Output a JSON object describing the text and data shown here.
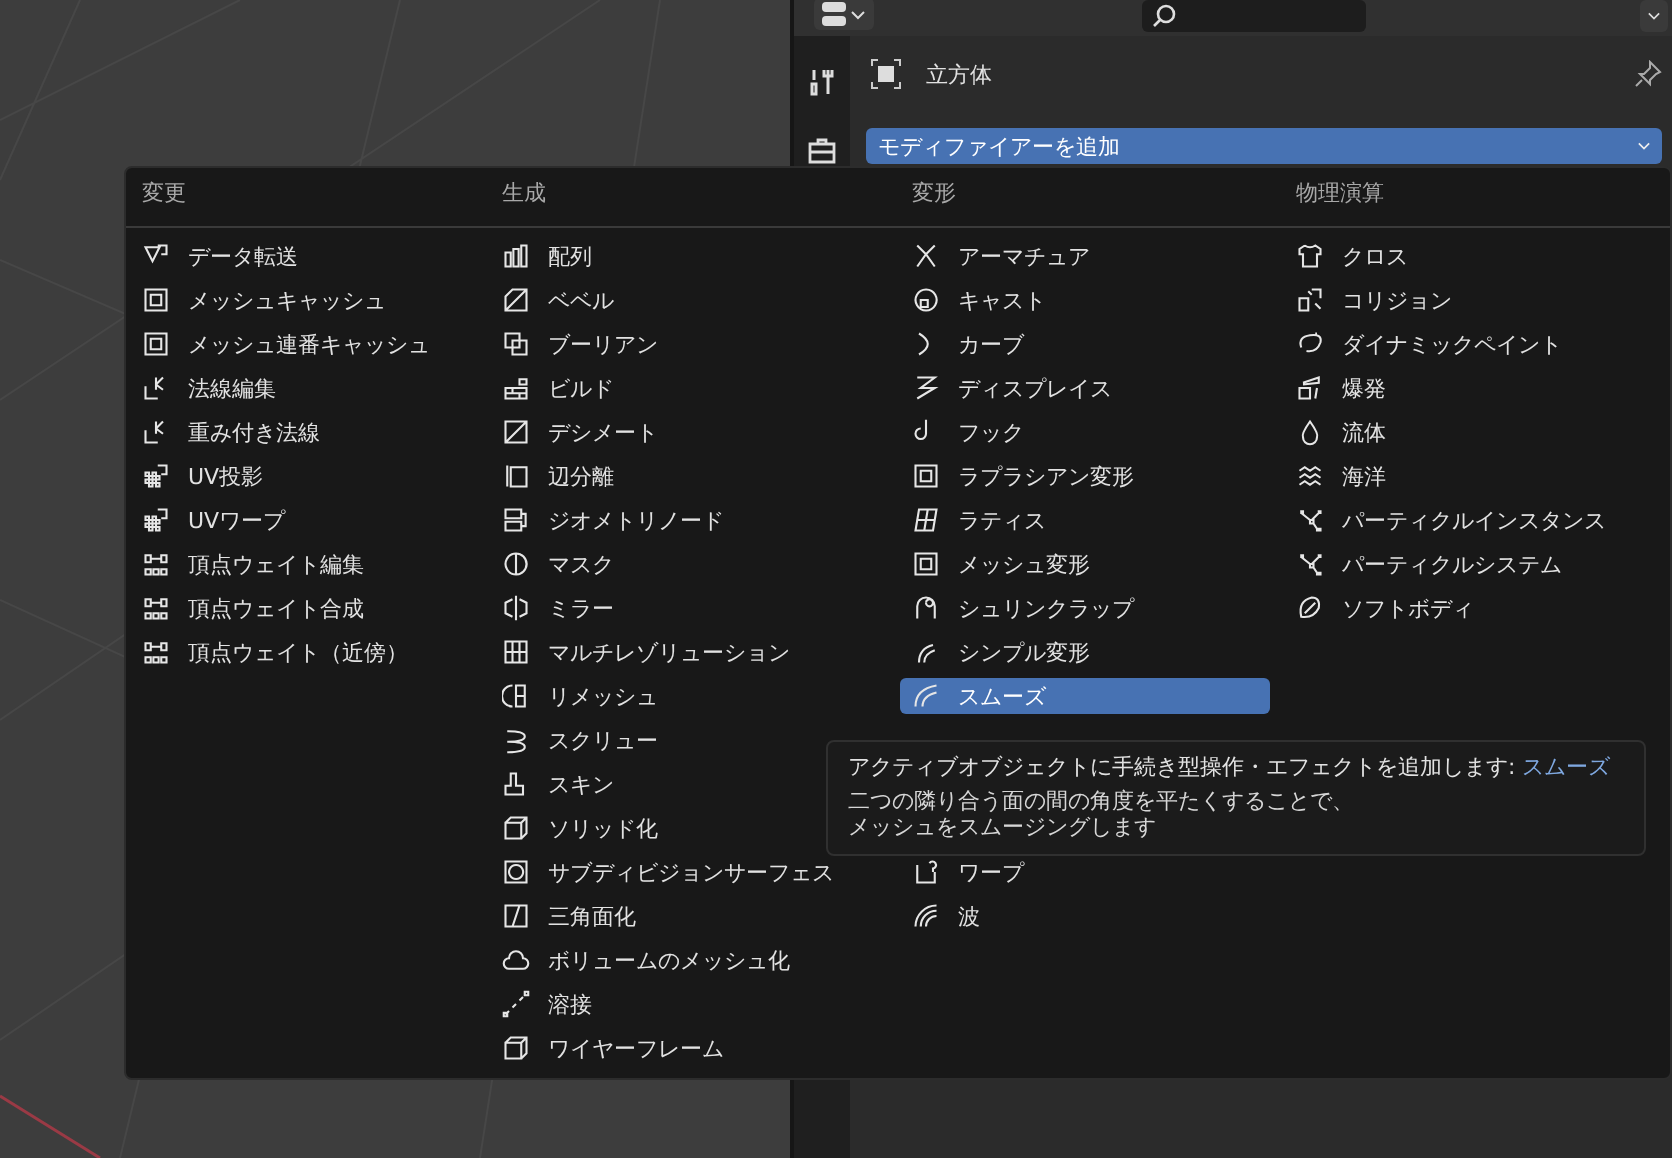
{
  "properties": {
    "object_name": "立方体",
    "add_modifier": "モディファイアーを追加"
  },
  "menu": {
    "columns": [
      {
        "title": "変更",
        "items": [
          {
            "label": "データ転送",
            "selected": false
          },
          {
            "label": "メッシュキャッシュ",
            "selected": false
          },
          {
            "label": "メッシュ連番キャッシュ",
            "selected": false
          },
          {
            "label": "法線編集",
            "selected": false
          },
          {
            "label": "重み付き法線",
            "selected": false
          },
          {
            "label": "UV投影",
            "selected": false
          },
          {
            "label": "UVワープ",
            "selected": false
          },
          {
            "label": "頂点ウェイト編集",
            "selected": false
          },
          {
            "label": "頂点ウェイト合成",
            "selected": false
          },
          {
            "label": "頂点ウェイト（近傍）",
            "selected": false
          }
        ]
      },
      {
        "title": "生成",
        "items": [
          {
            "label": "配列",
            "selected": false
          },
          {
            "label": "ベベル",
            "selected": false
          },
          {
            "label": "ブーリアン",
            "selected": false
          },
          {
            "label": "ビルド",
            "selected": false
          },
          {
            "label": "デシメート",
            "selected": false
          },
          {
            "label": "辺分離",
            "selected": false
          },
          {
            "label": "ジオメトリノード",
            "selected": false
          },
          {
            "label": "マスク",
            "selected": false
          },
          {
            "label": "ミラー",
            "selected": false
          },
          {
            "label": "マルチレゾリューション",
            "selected": false
          },
          {
            "label": "リメッシュ",
            "selected": false
          },
          {
            "label": "スクリュー",
            "selected": false
          },
          {
            "label": "スキン",
            "selected": false
          },
          {
            "label": "ソリッド化",
            "selected": false
          },
          {
            "label": "サブディビジョンサーフェス",
            "selected": false
          },
          {
            "label": "三角面化",
            "selected": false
          },
          {
            "label": "ボリュームのメッシュ化",
            "selected": false
          },
          {
            "label": "溶接",
            "selected": false
          },
          {
            "label": "ワイヤーフレーム",
            "selected": false
          }
        ]
      },
      {
        "title": "変形",
        "items": [
          {
            "label": "アーマチュア",
            "selected": false
          },
          {
            "label": "キャスト",
            "selected": false
          },
          {
            "label": "カーブ",
            "selected": false
          },
          {
            "label": "ディスプレイス",
            "selected": false
          },
          {
            "label": "フック",
            "selected": false
          },
          {
            "label": "ラプラシアン変形",
            "selected": false
          },
          {
            "label": "ラティス",
            "selected": false
          },
          {
            "label": "メッシュ変形",
            "selected": false
          },
          {
            "label": "シュリンクラップ",
            "selected": false
          },
          {
            "label": "シンプル変形",
            "selected": false
          },
          {
            "label": "スムーズ",
            "selected": true
          },
          {
            "kind": "covered"
          },
          {
            "kind": "covered"
          },
          {
            "kind": "covered"
          },
          {
            "label": "ワープ",
            "selected": false
          },
          {
            "label": "波",
            "selected": false
          }
        ]
      },
      {
        "title": "物理演算",
        "items": [
          {
            "label": "クロス",
            "selected": false
          },
          {
            "label": "コリジョン",
            "selected": false
          },
          {
            "label": "ダイナミックペイント",
            "selected": false
          },
          {
            "label": "爆発",
            "selected": false
          },
          {
            "label": "流体",
            "selected": false
          },
          {
            "label": "海洋",
            "selected": false
          },
          {
            "label": "パーティクルインスタンス",
            "selected": false
          },
          {
            "label": "パーティクルシステム",
            "selected": false
          },
          {
            "label": "ソフトボディ",
            "selected": false
          }
        ]
      }
    ]
  },
  "tooltip": {
    "text": "アクティブオブジェクトに手続き型操作・エフェクトを追加します: ",
    "highlight": "スムーズ",
    "description": [
      "二つの隣り合う面の間の角度を平たくすることで、",
      "メッシュをスムージングします"
    ]
  }
}
